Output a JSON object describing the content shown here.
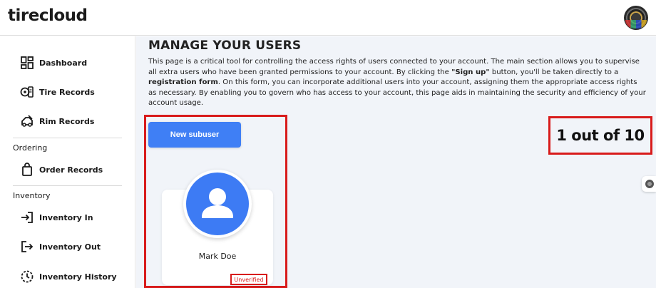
{
  "header": {
    "logo_text": "tirecloud",
    "avatar_icon": "user-avatar-icon"
  },
  "sidebar": {
    "items": [
      {
        "label": "Dashboard",
        "icon": "dashboard-icon"
      },
      {
        "label": "Tire Records",
        "icon": "tire-records-icon"
      },
      {
        "label": "Rim Records",
        "icon": "rim-records-icon"
      }
    ],
    "section_ordering": "Ordering",
    "ordering_items": [
      {
        "label": "Order Records",
        "icon": "shopping-bag-icon"
      }
    ],
    "section_inventory": "Inventory",
    "inventory_items": [
      {
        "label": "Inventory In",
        "icon": "sign-in-icon"
      },
      {
        "label": "Inventory Out",
        "icon": "sign-out-icon"
      },
      {
        "label": "Inventory History",
        "icon": "history-icon"
      }
    ]
  },
  "main": {
    "title": "MANAGE YOUR USERS",
    "description_parts": {
      "p1": "This page is a critical tool for controlling the access rights of users connected to your account. The main section allows you to supervise all extra users who have been granted permissions to your account. By clicking the ",
      "signup": "\"Sign up\"",
      "p2": " button, you'll be taken directly to a ",
      "regform": "registration form",
      "p3": ". On this form, you can incorporate additional users into your account, assigning them the appropriate access rights as necessary. By enabling you to govern who has access to your account, this page aids in maintaining the security and efficiency of your account usage."
    },
    "new_subuser_label": "New subuser",
    "user_count": "1 out of 10",
    "users": [
      {
        "name": "Mark Doe",
        "status": "Unverified"
      }
    ]
  },
  "colors": {
    "accent": "#3f7ff5",
    "highlight_red": "#d81b1b",
    "main_bg": "#f1f4f9"
  }
}
